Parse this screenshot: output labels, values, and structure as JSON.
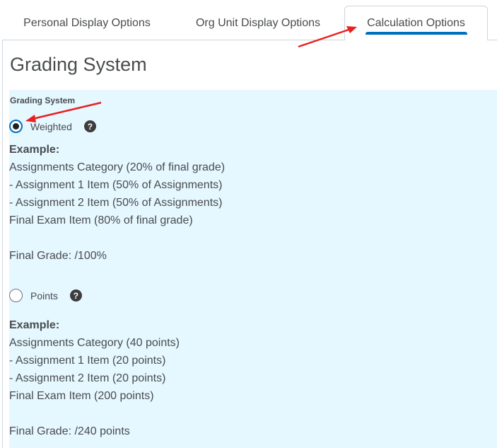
{
  "tabs": [
    {
      "label": "Personal Display Options",
      "active": false
    },
    {
      "label": "Org Unit Display Options",
      "active": false
    },
    {
      "label": "Calculation Options",
      "active": true
    }
  ],
  "page_title": "Grading System",
  "grading_system": {
    "label": "Grading System",
    "options": [
      {
        "label": "Weighted",
        "checked": true,
        "help_icon": "question-circle-icon",
        "example": {
          "heading": "Example:",
          "lines": [
            "Assignments Category (20% of final grade)",
            "- Assignment 1 Item (50% of Assignments)",
            "- Assignment 2 Item (50% of Assignments)",
            "Final Exam Item (80% of final grade)"
          ],
          "final": "Final Grade: /100%"
        }
      },
      {
        "label": "Points",
        "checked": false,
        "help_icon": "question-circle-icon",
        "example": {
          "heading": "Example:",
          "lines": [
            "Assignments Category (40 points)",
            "- Assignment 1 Item (20 points)",
            "- Assignment 2 Item (20 points)",
            "Final Exam Item (200 points)"
          ],
          "final": "Final Grade: /240 points"
        }
      }
    ]
  },
  "colors": {
    "accent": "#006fbf",
    "section_bg": "#e5f7ff",
    "annotation_arrow": "#e8201f"
  }
}
